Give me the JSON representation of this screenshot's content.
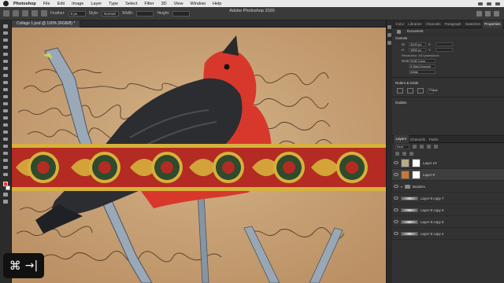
{
  "menubar": {
    "app": "Photoshop",
    "items": [
      "File",
      "Edit",
      "Image",
      "Layer",
      "Type",
      "Select",
      "Filter",
      "3D",
      "View",
      "Window",
      "Help"
    ]
  },
  "optbar": {
    "window_title": "Adobe Photoshop 2020",
    "feather_label": "Feather:",
    "feather_value": "0 px",
    "style_label": "Style:",
    "style_value": "Normal",
    "width_label": "Width:",
    "height_label": "Height:"
  },
  "document": {
    "tab_title": "Collage 1.psd @ 100% (RGB/8) *"
  },
  "panels": {
    "top_tabs": [
      "Color",
      "Libraries",
      "Channels",
      "Paragraph",
      "Swatches",
      "Properties"
    ],
    "properties": {
      "document_label": "Document",
      "canvas_section": "Canvas",
      "w_label": "W",
      "w_value": "3200 px",
      "h_label": "H",
      "h_value": "1800 px",
      "x_label": "X",
      "y_label": "Y",
      "resolution": "Resolution: 300 pixels/inch",
      "mode_label": "Mode",
      "mode_value": "RGB Color",
      "bit_value": "8 Bits/Channel",
      "fill_value": "White",
      "rulers_section": "Rulers & Grids",
      "ruler_unit": "Pixels",
      "guides_section": "Guides"
    },
    "layers": {
      "tabs": [
        "Layers",
        "Channels",
        "Paths"
      ],
      "kind_label": "Kind",
      "items": [
        {
          "name": "Layer 10",
          "selected": false
        },
        {
          "name": "Layer 9",
          "selected": true
        },
        {
          "name": "Borders",
          "selected": false
        },
        {
          "name": "Layer 8 copy 7",
          "selected": false
        },
        {
          "name": "Layer 8 copy 6",
          "selected": false
        },
        {
          "name": "Layer 8 copy 5",
          "selected": false
        },
        {
          "name": "Layer 8 copy 4",
          "selected": false
        }
      ]
    }
  },
  "badge": {
    "symbol_command": "⌘",
    "symbol_arrow": "→|"
  },
  "colors": {
    "foreground": "#e83b2a",
    "background": "#ffffff",
    "canvas_paper": "#c9a47a",
    "bird_red": "#d8382b"
  }
}
